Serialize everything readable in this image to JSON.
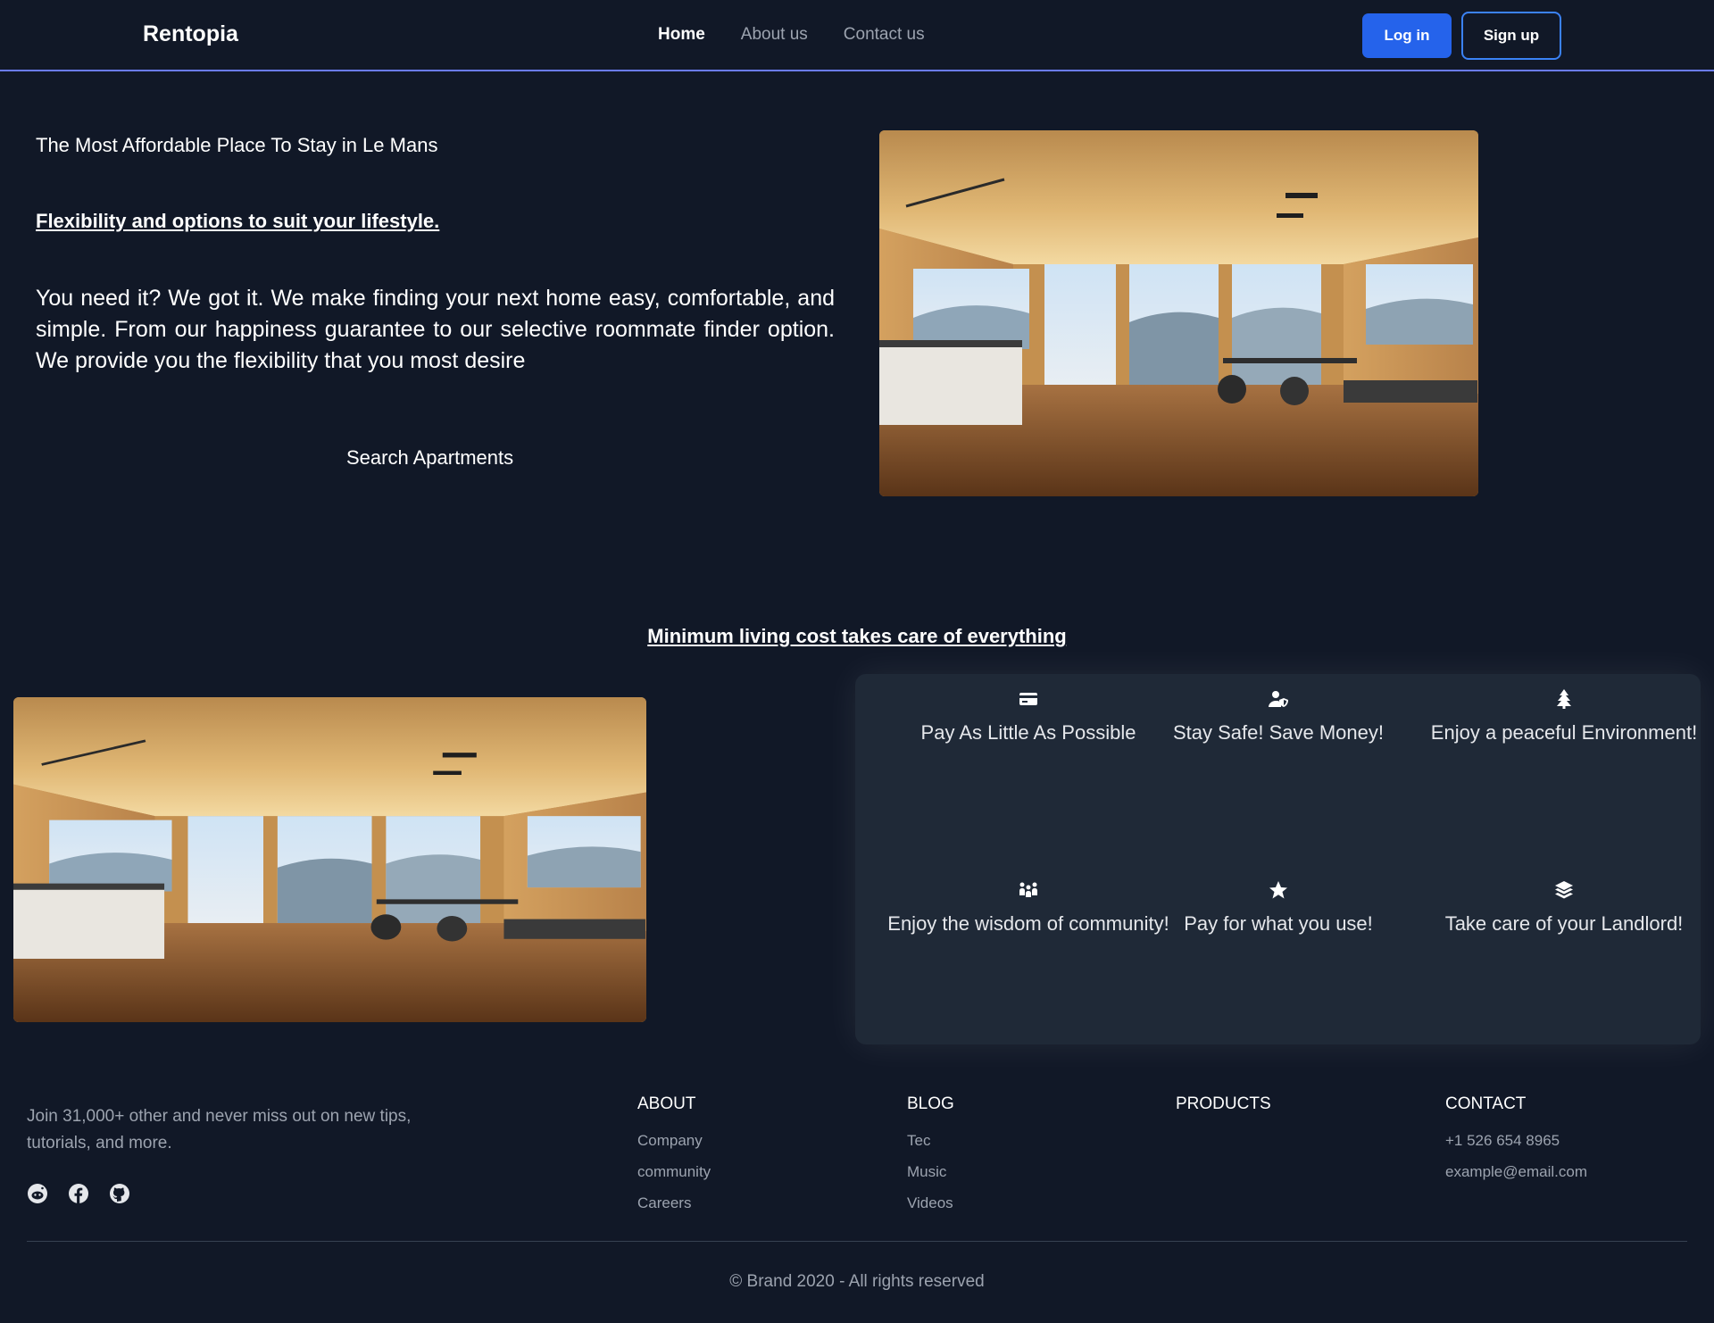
{
  "nav": {
    "brand": "Rentopia",
    "links": [
      "Home",
      "About us",
      "Contact us"
    ],
    "login_label": "Log in",
    "signup_label": "Sign up"
  },
  "hero": {
    "tagline": "The Most Affordable Place To Stay in Le Mans",
    "heading": "Flexibility and options to suit your lifestyle.",
    "description": "You need it? We got it. We make finding your next home easy, comfortable, and simple. From our happiness guarantee to our selective roommate finder option. We provide you the flexibility that you most desire",
    "cta_label": "Search Apartments"
  },
  "features": {
    "heading": "Minimum living cost takes care of everything",
    "items": [
      {
        "icon": "credit-card-icon",
        "label": "Pay As Little As Possible"
      },
      {
        "icon": "user-shield-icon",
        "label": "Stay Safe! Save Money!"
      },
      {
        "icon": "tree-icon",
        "label": "Enjoy a peaceful Environment!"
      },
      {
        "icon": "people-group-icon",
        "label": "Enjoy the wisdom of community!"
      },
      {
        "icon": "star-icon",
        "label": "Pay for what you use!"
      },
      {
        "icon": "layers-icon",
        "label": "Take care of your Landlord!"
      }
    ]
  },
  "footer": {
    "blurb": "Join 31,000+ other and never miss out on new tips, tutorials, and more.",
    "socials": [
      "reddit-icon",
      "facebook-icon",
      "github-icon"
    ],
    "columns": [
      {
        "title": "ABOUT",
        "links": [
          "Company",
          "community",
          "Careers"
        ]
      },
      {
        "title": "BLOG",
        "links": [
          "Tec",
          "Music",
          "Videos"
        ]
      },
      {
        "title": "PRODUCTS",
        "links": []
      },
      {
        "title": "CONTACT",
        "links": [
          "+1 526 654 8965",
          "example@email.com"
        ]
      }
    ],
    "copyright": "© Brand 2020 - All rights reserved"
  },
  "colors": {
    "background": "#111827",
    "panel": "#1f2937",
    "accent": "#2563eb",
    "nav_border": "#6b7cf6",
    "muted_text": "#9ca3af"
  }
}
